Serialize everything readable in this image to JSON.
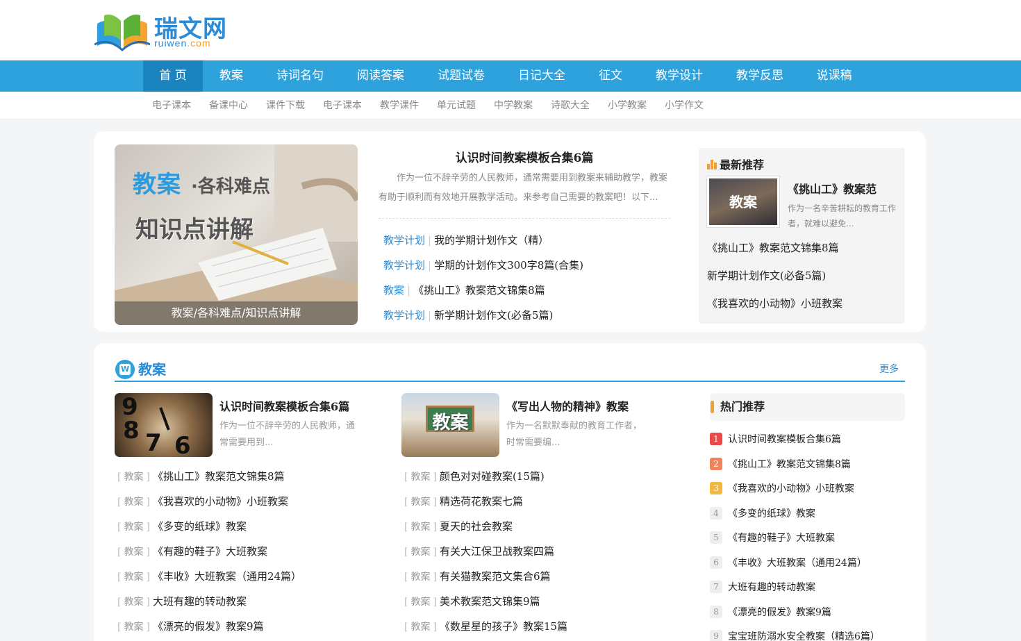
{
  "logo": {
    "name": "瑞文网",
    "sub": "ruiwen",
    "sub_dot": ".com"
  },
  "nav": [
    "首 页",
    "教案",
    "诗词名句",
    "阅读答案",
    "试题试卷",
    "日记大全",
    "征文",
    "教学设计",
    "教学反思",
    "说课稿"
  ],
  "subnav": [
    "电子课本",
    "备课中心",
    "课件下载",
    "电子课本",
    "教学课件",
    "单元试题",
    "中学教案",
    "诗歌大全",
    "小学教案",
    "小学作文"
  ],
  "feature": {
    "img_title1": "教案",
    "img_title2": "·各科难点",
    "img_title3": "知识点讲解",
    "caption": "教案/各科难点/知识点讲解",
    "headline": "认识时间教案模板合集6篇",
    "desc": "作为一位不辞辛劳的人民教师，通常需要用到教案来辅助教学，教案有助于顺利而有效地开展教学活动。来参考自己需要的教案吧！以下...",
    "links": [
      {
        "cat": "教学计划",
        "title": "我的学期计划作文（精）"
      },
      {
        "cat": "教学计划",
        "title": "学期的计划作文300字8篇(合集)"
      },
      {
        "cat": "教案",
        "title": "《挑山工》教案范文锦集8篇"
      },
      {
        "cat": "教学计划",
        "title": "新学期计划作文(必备5篇)"
      }
    ]
  },
  "recommend": {
    "heading": "最新推荐",
    "thumb_label": "教案",
    "top_title": "《挑山工》教案范",
    "top_desc": "作为一名辛苦耕耘的教育工作者，就难以避免...",
    "items": [
      "《挑山工》教案范文锦集8篇",
      "新学期计划作文(必备5篇)",
      "《我喜欢的小动物》小班教案"
    ]
  },
  "section": {
    "title": "教案",
    "icon_label": "W",
    "more": "更多",
    "col1": {
      "card_title": "认识时间教案模板合集6篇",
      "card_desc": "作为一位不辞辛劳的人民教师，通常需要用到...",
      "clock_digits": [
        "9",
        "8",
        "7",
        "6"
      ],
      "tag": "教案",
      "items": [
        "《挑山工》教案范文锦集8篇",
        "《我喜欢的小动物》小班教案",
        "《多变的纸球》教案",
        "《有趣的鞋子》大班教案",
        "《丰收》大班教案（通用24篇）",
        "大班有趣的转动教案",
        "《漂亮的假发》教案9篇"
      ]
    },
    "col2": {
      "card_title": "《写出人物的精神》教案",
      "card_desc": "作为一名默默奉献的教育工作者，时常需要编...",
      "img_label": "教案",
      "tag": "教案",
      "items": [
        "颜色对对碰教案(15篇)",
        "精选荷花教案七篇",
        "夏天的社会教案",
        "有关大江保卫战教案四篇",
        "有关猫教案范文集合6篇",
        "美术教案范文锦集9篇",
        "《数星星的孩子》教案15篇"
      ]
    },
    "hot": {
      "title": "热门推荐",
      "items": [
        {
          "n": "1",
          "t": "认识时间教案模板合集6篇"
        },
        {
          "n": "2",
          "t": "《挑山工》教案范文锦集8篇"
        },
        {
          "n": "3",
          "t": "《我喜欢的小动物》小班教案"
        },
        {
          "n": "4",
          "t": "《多变的纸球》教案"
        },
        {
          "n": "5",
          "t": "《有趣的鞋子》大班教案"
        },
        {
          "n": "6",
          "t": "《丰收》大班教案（通用24篇）"
        },
        {
          "n": "7",
          "t": "大班有趣的转动教案"
        },
        {
          "n": "8",
          "t": "《漂亮的假发》教案9篇"
        },
        {
          "n": "9",
          "t": "宝宝班防溺水安全教案（精选6篇）"
        }
      ]
    }
  },
  "colors": {
    "primary": "#2ea2dd",
    "nav_active": "#1b83bd",
    "accent": "#f0a030",
    "link": "#2a8bd6"
  }
}
